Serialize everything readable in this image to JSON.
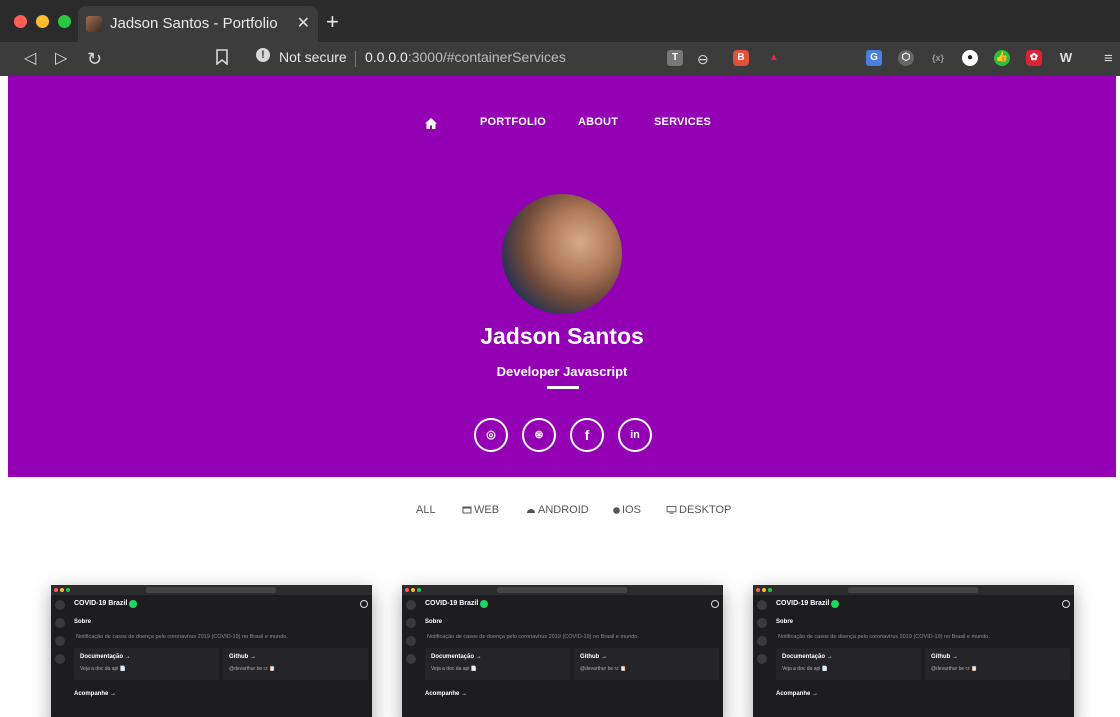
{
  "browser": {
    "tab_title": "Jadson Santos - Portfolio",
    "tab_close": "✕",
    "new_tab": "+",
    "security_label": "Not secure",
    "url_host": "0.0.0.0",
    "url_path": ":3000/#containerServices",
    "traffic_lights": {
      "close": "#ff5f57",
      "minimize": "#febc2e",
      "maximize": "#28c840"
    }
  },
  "nav": {
    "home_icon": "home-icon",
    "items": [
      {
        "label": "PORTFOLIO"
      },
      {
        "label": "ABOUT"
      },
      {
        "label": "SERVICES"
      }
    ]
  },
  "profile": {
    "name": "Jadson Santos",
    "role": "Developer Javascript",
    "background": "#9400b3"
  },
  "social": [
    {
      "icon": "instagram-icon",
      "glyph": "◎"
    },
    {
      "icon": "github-icon",
      "glyph": "⊛"
    },
    {
      "icon": "facebook-icon",
      "glyph": "f"
    },
    {
      "icon": "linkedin-icon",
      "glyph": "in"
    }
  ],
  "filters": [
    {
      "label": "ALL",
      "icon": ""
    },
    {
      "label": "WEB",
      "icon": "web-icon"
    },
    {
      "label": "ANDROID",
      "icon": "android-icon"
    },
    {
      "label": "IOS",
      "icon": "apple-icon"
    },
    {
      "label": "DESKTOP",
      "icon": "desktop-icon"
    }
  ],
  "projects": [
    {
      "title": "COVID-19 Brazil",
      "section": "Sobre",
      "description": "Notificação de casos de doença pelo coronavírus 2019 (COVID-19) no Brasil e mundo.",
      "doc_title": "Documentação →",
      "doc_sub": "Veja a doc da api 📄",
      "github_title": "Github →",
      "github_sub": "@devarthur be rz 📋",
      "follow": "Acompanhe →"
    },
    {
      "title": "COVID-19 Brazil",
      "section": "Sobre",
      "description": "Notificação de casos de doença pelo coronavírus 2019 (COVID-19) no Brasil e mundo.",
      "doc_title": "Documentação →",
      "doc_sub": "Veja a doc da api 📄",
      "github_title": "Github →",
      "github_sub": "@devarthur be rz 📋",
      "follow": "Acompanhe →"
    },
    {
      "title": "COVID-19 Brazil",
      "section": "Sobre",
      "description": "Notificação de casos de doença pelo coronavírus 2019 (COVID-19) no Brasil e mundo.",
      "doc_title": "Documentação →",
      "doc_sub": "Veja a doc da api 📄",
      "github_title": "Github →",
      "github_sub": "@devarthur be rz 📋",
      "follow": "Acompanhe →"
    }
  ]
}
